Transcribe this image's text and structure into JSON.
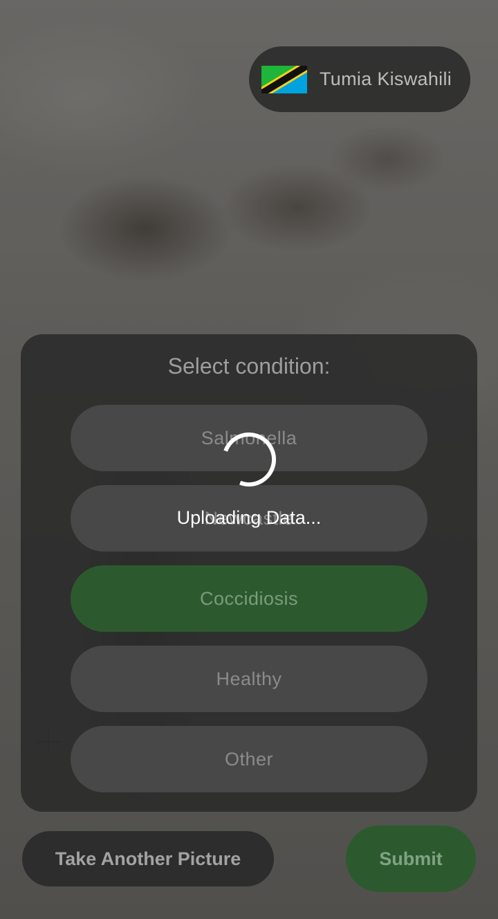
{
  "language_toggle": {
    "label": "Tumia Kiswahili",
    "flag_icon": "tanzania-flag-icon"
  },
  "condition_panel": {
    "title": "Select condition:",
    "options": [
      {
        "label": "Salmonella",
        "selected": false
      },
      {
        "label": "Newcastle",
        "selected": false
      },
      {
        "label": "Coccidiosis",
        "selected": true
      },
      {
        "label": "Healthy",
        "selected": false
      },
      {
        "label": "Other",
        "selected": false
      }
    ]
  },
  "actions": {
    "take_another_label": "Take Another Picture",
    "submit_label": "Submit"
  },
  "loading": {
    "text": "Uploading Data..."
  },
  "colors": {
    "selected_green": "#2c5a2e",
    "panel": "#2a2a2a",
    "button": "#484848"
  }
}
